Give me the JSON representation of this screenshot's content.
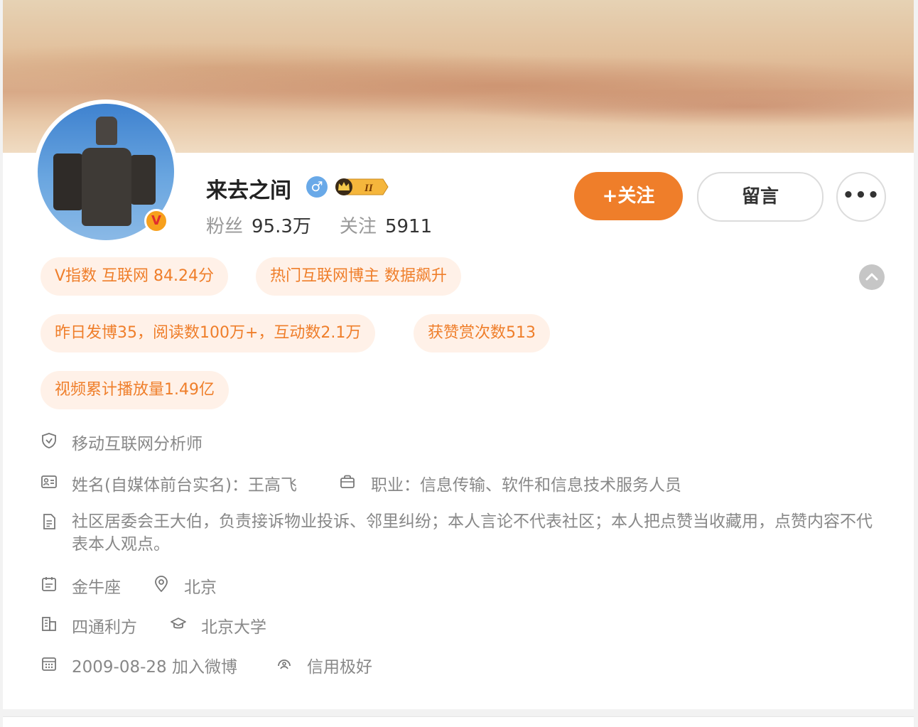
{
  "profile": {
    "name": "来去之间",
    "vip_level": "II",
    "verified_badge": "V",
    "gender_symbol": "♂",
    "fans_label": "粉丝",
    "fans_value": "95.3万",
    "following_label": "关注",
    "following_value": "5911"
  },
  "actions": {
    "follow_label": "+关注",
    "message_label": "留言",
    "more_label": "•••"
  },
  "tags": [
    "V指数 互联网 84.24分",
    "热门互联网博主 数据飙升",
    "昨日发博35，阅读数100万+，互动数2.1万",
    "获赞赏次数513",
    "视频累计播放量1.49亿"
  ],
  "info": {
    "certification": "移动互联网分析师",
    "real_name": "姓名(自媒体前台实名)：王高飞",
    "occupation": "职业：信息传输、软件和信息技术服务人员",
    "description": "社区居委会王大伯，负责接诉物业投诉、邻里纠纷；本人言论不代表社区；本人把点赞当收藏用，点赞内容不代表本人观点。",
    "constellation": "金牛座",
    "location": "北京",
    "company": "四通利方",
    "school": "北京大学",
    "join_date": "2009-08-28 加入微博",
    "credit": "信用极好"
  },
  "colors": {
    "accent": "#ef7e2a",
    "tag_bg": "#fff1e8",
    "muted_text": "#888888"
  },
  "icons": [
    "shield-icon",
    "id-card-icon",
    "briefcase-icon",
    "document-icon",
    "calendar-small-icon",
    "location-pin-icon",
    "building-icon",
    "graduation-cap-icon",
    "calendar-icon",
    "credit-icon",
    "chevron-up-icon"
  ]
}
